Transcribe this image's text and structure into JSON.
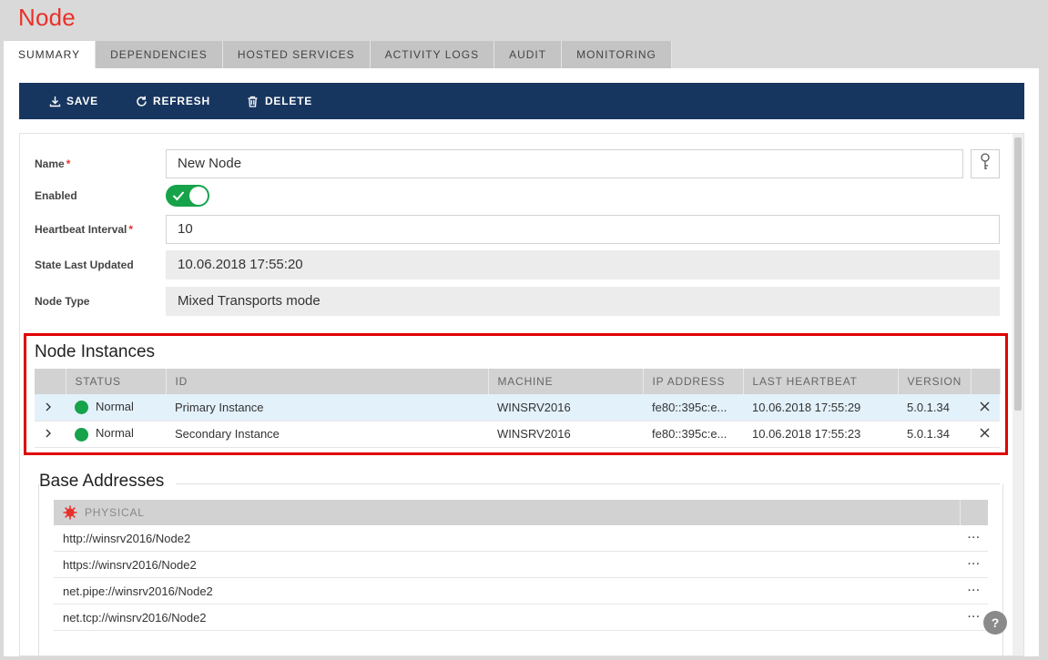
{
  "page": {
    "title": "Node"
  },
  "tabs": [
    {
      "label": "SUMMARY",
      "active": true
    },
    {
      "label": "DEPENDENCIES"
    },
    {
      "label": "HOSTED SERVICES"
    },
    {
      "label": "ACTIVITY LOGS"
    },
    {
      "label": "AUDIT"
    },
    {
      "label": "MONITORING"
    }
  ],
  "toolbar": {
    "save_label": "SAVE",
    "refresh_label": "REFRESH",
    "delete_label": "DELETE",
    "save_icon": "download-icon",
    "refresh_icon": "refresh-icon",
    "delete_icon": "trash-icon"
  },
  "form": {
    "name": {
      "label": "Name",
      "required_mark": "*",
      "value": "New Node"
    },
    "enabled": {
      "label": "Enabled",
      "on": true
    },
    "heartbeat": {
      "label": "Heartbeat Interval",
      "required_mark": "*",
      "value": "10"
    },
    "state_last_updated": {
      "label": "State Last Updated",
      "value": "10.06.2018 17:55:20"
    },
    "node_type": {
      "label": "Node Type",
      "value": "Mixed Transports mode"
    },
    "key_icon": "key-icon"
  },
  "instances": {
    "title": "Node Instances",
    "columns": [
      "STATUS",
      "ID",
      "MACHINE",
      "IP ADDRESS",
      "LAST HEARTBEAT",
      "VERSION"
    ],
    "rows": [
      {
        "status": "Normal",
        "id": "Primary Instance",
        "machine": "WINSRV2016",
        "ip": "fe80::395c:e...",
        "last_heartbeat": "10.06.2018 17:55:29",
        "version": "5.0.1.34",
        "selected": true
      },
      {
        "status": "Normal",
        "id": "Secondary Instance",
        "machine": "WINSRV2016",
        "ip": "fe80::395c:e...",
        "last_heartbeat": "10.06.2018 17:55:23",
        "version": "5.0.1.34"
      }
    ],
    "status_color": "#16a34a",
    "highlight_color": "#e00000"
  },
  "base_addresses": {
    "title": "Base Addresses",
    "header": "PHYSICAL",
    "header_icon": "error-icon",
    "more_label": "···",
    "rows": [
      "http://winsrv2016/Node2",
      "https://winsrv2016/Node2",
      "net.pipe://winsrv2016/Node2",
      "net.tcp://winsrv2016/Node2"
    ]
  },
  "help": {
    "label": "?"
  },
  "colors": {
    "brand": "#e8312a",
    "toolbar": "#17365f",
    "toggle_on": "#16a34a"
  }
}
